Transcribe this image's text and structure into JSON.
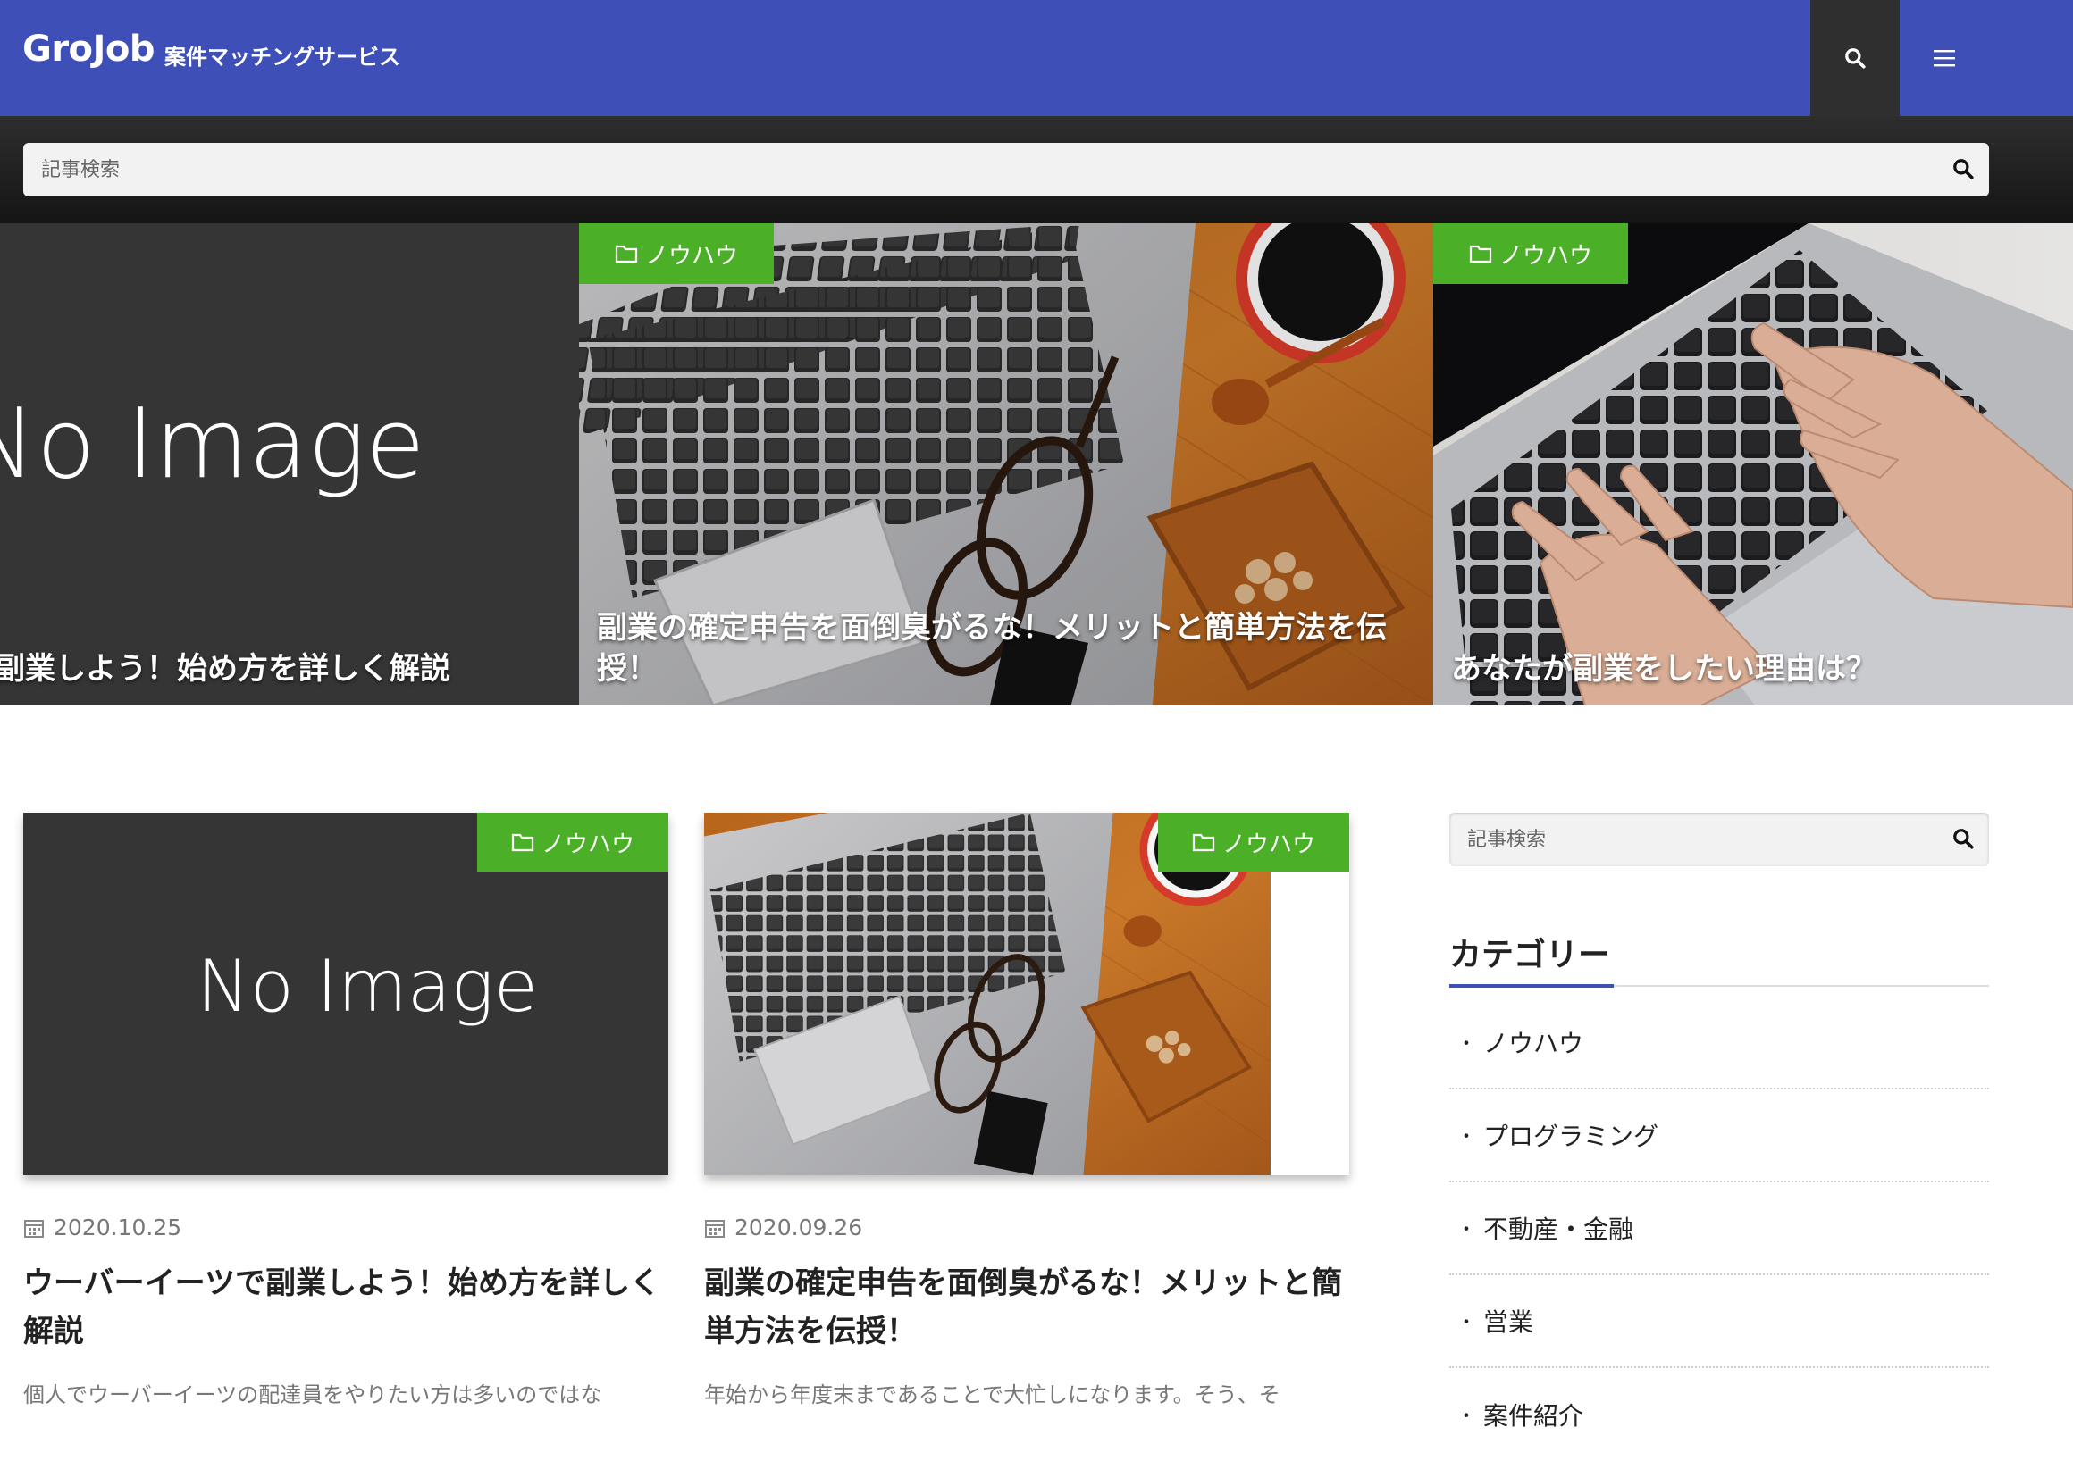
{
  "header": {
    "logo": "GroJob",
    "tagline": "案件マッチングサービス",
    "search_icon": "search-icon",
    "menu_icon": "hamburger-menu-icon"
  },
  "search": {
    "placeholder": "記事検索"
  },
  "no_image_text": "No Image",
  "slider": [
    {
      "title": "副業しよう！始め方を詳しく解説",
      "category": "",
      "thumb": "no-image"
    },
    {
      "title": "副業の確定申告を面倒臭がるな！メリットと簡単方法を伝授！",
      "category": "ノウハウ",
      "thumb": "laptop-coffee-photo"
    },
    {
      "title": "あなたが副業をしたい理由は？",
      "category": "ノウハウ",
      "thumb": "typing-laptop-photo"
    }
  ],
  "cards": [
    {
      "category": "ノウハウ",
      "date": "2020.10.25",
      "title": "ウーバーイーツで副業しよう！始め方を詳しく解説",
      "excerpt": "個人でウーバーイーツの配達員をやりたい方は多いのではな",
      "thumb": "no-image"
    },
    {
      "category": "ノウハウ",
      "date": "2020.09.26",
      "title": "副業の確定申告を面倒臭がるな！メリットと簡単方法を伝授！",
      "excerpt": "年始から年度末まであることで大忙しになります。そう、そ",
      "thumb": "laptop-coffee-photo"
    }
  ],
  "sidebar": {
    "search_placeholder": "記事検索",
    "category_heading": "カテゴリー",
    "categories": [
      "ノウハウ",
      "プログラミング",
      "不動産・金融",
      "営業",
      "案件紹介"
    ]
  },
  "colors": {
    "brand": "#3f4fb8",
    "badge": "#4caf28",
    "dark": "#353535"
  }
}
